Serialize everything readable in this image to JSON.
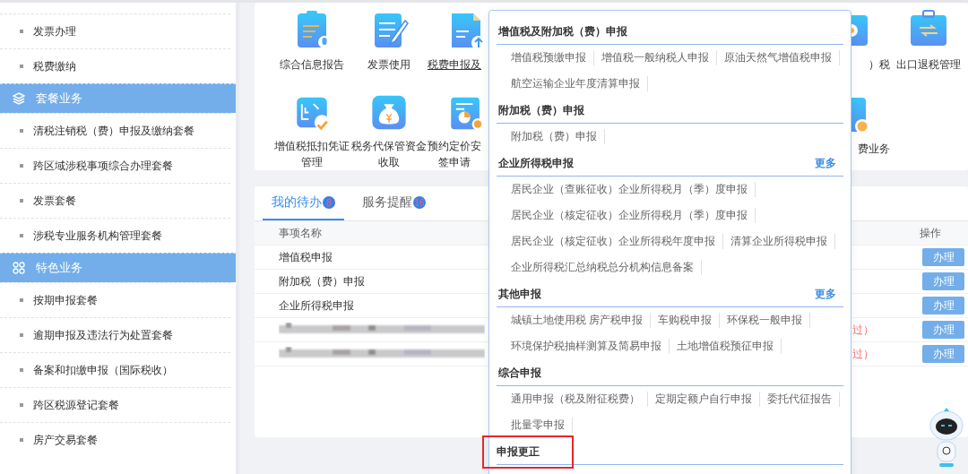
{
  "sidebar": {
    "items": [
      {
        "kind": "item",
        "label": "发票办理"
      },
      {
        "kind": "item",
        "label": "税费缴纳"
      },
      {
        "kind": "section",
        "label": "套餐业务"
      },
      {
        "kind": "item",
        "label": "清税注销税（费）申报及缴纳套餐"
      },
      {
        "kind": "item",
        "label": "跨区域涉税事项综合办理套餐"
      },
      {
        "kind": "item",
        "label": "发票套餐"
      },
      {
        "kind": "item",
        "label": "涉税专业服务机构管理套餐"
      },
      {
        "kind": "section",
        "label": "特色业务"
      },
      {
        "kind": "item",
        "label": "按期申报套餐"
      },
      {
        "kind": "item",
        "label": "逾期申报及违法行为处置套餐"
      },
      {
        "kind": "item",
        "label": "备案和扣缴申报（国际税收）"
      },
      {
        "kind": "item",
        "label": "跨区税源登记套餐"
      },
      {
        "kind": "item",
        "label": "房产交易套餐"
      }
    ]
  },
  "services": [
    {
      "kind": "full",
      "lines": [
        "综合信息报告"
      ],
      "underlined": false
    },
    {
      "kind": "full",
      "lines": [
        "发票使用"
      ],
      "underlined": false
    },
    {
      "kind": "cut_right",
      "lines": [
        "税费申报及"
      ],
      "underlined": true
    },
    {
      "kind": "cut_left",
      "lines": [
        "）税"
      ],
      "underlined": false
    },
    {
      "kind": "full",
      "lines": [
        "出口退税管理"
      ],
      "underlined": false
    },
    {
      "kind": "full",
      "lines": [
        "增值税抵扣凭证",
        "管理"
      ],
      "underlined": false
    },
    {
      "kind": "full",
      "lines": [
        "税务代保管资金",
        "收取"
      ],
      "underlined": false
    },
    {
      "kind": "cut_right",
      "lines": [
        "预约定价安",
        "签申请"
      ],
      "underlined": false
    },
    {
      "kind": "cut_left",
      "lines": [
        "费业务"
      ],
      "underlined": false
    }
  ],
  "todo": {
    "tabs": [
      {
        "label": "我的待办",
        "badge": "8",
        "selected": true
      },
      {
        "label": "服务提醒",
        "badge": "16",
        "selected": false
      }
    ],
    "columns": [
      "事项名称",
      "操作"
    ],
    "rows": [
      {
        "kind": "text",
        "name": "增值税申报",
        "action": "办理"
      },
      {
        "kind": "text",
        "name": "附加税（费）申报",
        "action": "办理"
      },
      {
        "kind": "text",
        "name": "企业所得税申报",
        "action": "办理"
      },
      {
        "kind": "redacted",
        "status": "过）",
        "action": "办理"
      },
      {
        "kind": "redacted",
        "status": "过）",
        "action": "办理"
      }
    ]
  },
  "popup": {
    "sections": [
      {
        "title": "增值税及附加税（费）申报",
        "highlighted": false,
        "rows": [
          [
            "增值税预缴申报",
            "增值税一般纳税人申报",
            "原油天然气增值税申报"
          ],
          [
            "航空运输企业年度清算申报"
          ]
        ]
      },
      {
        "title": "附加税（费）申报",
        "highlighted": false,
        "rows": [
          [
            "附加税（费）申报"
          ]
        ]
      },
      {
        "title": "企业所得税申报",
        "more": "更多",
        "highlighted": false,
        "rows": [
          [
            "居民企业（查账征收）企业所得税月（季）度申报"
          ],
          [
            "居民企业（核定征收）企业所得税月（季）度申报"
          ],
          [
            "居民企业（核定征收）企业所得税年度申报",
            "清算企业所得税申报"
          ],
          [
            "企业所得税汇总纳税总分机构信息备案"
          ]
        ]
      },
      {
        "title": "其他申报",
        "more": "更多",
        "highlighted": false,
        "rows": [
          [
            "城镇土地使用税 房产税申报",
            "车购税申报",
            "环保税一般申报"
          ],
          [
            "环境保护税抽样测算及简易申报",
            "土地增值税预征申报"
          ]
        ]
      },
      {
        "title": "综合申报",
        "highlighted": false,
        "rows": [
          [
            "通用申报（税及附征税费）",
            "定期定额户自行申报",
            "委托代征报告"
          ],
          [
            "批量零申报"
          ]
        ]
      },
      {
        "title": "申报更正",
        "highlighted": true
      }
    ]
  }
}
